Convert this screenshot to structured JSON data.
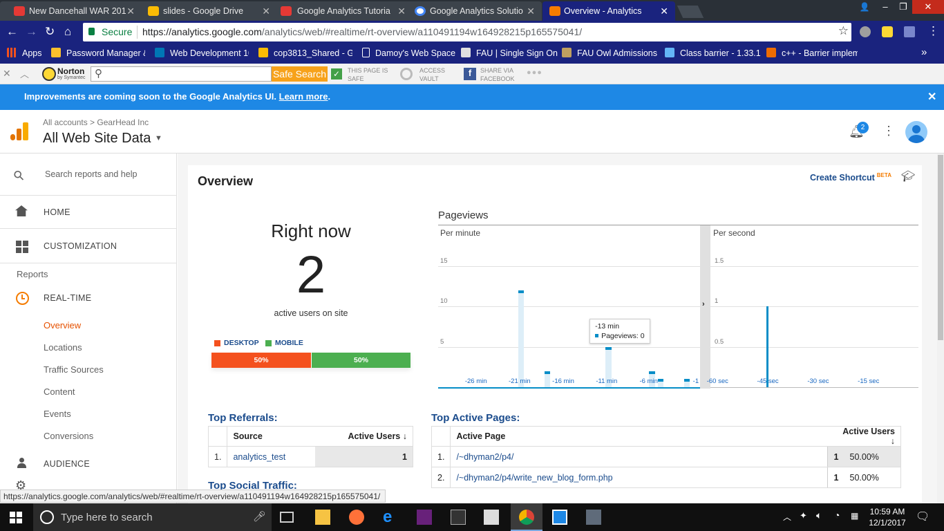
{
  "browser": {
    "tabs": [
      {
        "title": "New Dancehall WAR 201",
        "color": "#e53935"
      },
      {
        "title": "slides - Google Drive",
        "color": "#fbbc04"
      },
      {
        "title": "Google Analytics Tutoria",
        "color": "#e53935"
      },
      {
        "title": "Google Analytics Solutio",
        "color": "#4285f4"
      },
      {
        "title": "Overview - Analytics",
        "color": "#f57c00"
      }
    ],
    "secure_label": "Secure",
    "url_host": "https://analytics.google.com",
    "url_path": "/analytics/web/#realtime/rt-overview/a110491194w164928215p165575041/",
    "bookmarks": [
      {
        "label": "Apps",
        "color": "#f4511e"
      },
      {
        "label": "Password Manager &",
        "color": "#fbc02d"
      },
      {
        "label": "Web Development 10",
        "color": "#0077b5"
      },
      {
        "label": "cop3813_Shared - Go",
        "color": "#fbbc04"
      },
      {
        "label": "Damoy's Web Space",
        "color": "#ffffff"
      },
      {
        "label": "FAU | Single Sign On",
        "color": "#e0e0e0"
      },
      {
        "label": "FAU Owl Admissions",
        "color": "#c0a060"
      },
      {
        "label": "Class barrier - 1.33.1",
        "color": "#64b5f6"
      },
      {
        "label": "c++ - Barrier implem",
        "color": "#ef6c00"
      }
    ],
    "more": "»"
  },
  "norton": {
    "brand": "Norton",
    "brand_sub": "by Symantec",
    "search_button": "Safe Search",
    "safe_line1": "THIS PAGE IS",
    "safe_line2": "SAFE",
    "vault_line1": "ACCESS",
    "vault_line2": "VAULT",
    "fb_line1": "SHARE VIA",
    "fb_line2": "FACEBOOK",
    "more": "●●●"
  },
  "banner": {
    "text": "Improvements are coming soon to the Google Analytics UI. ",
    "link": "Learn more",
    "tail": ".",
    "close": "✕"
  },
  "header": {
    "breadcrumb_root": "All accounts",
    "breadcrumb_sep": ">",
    "breadcrumb_account": "GearHead Inc",
    "view_name": "All Web Site Data",
    "notif_count": "2"
  },
  "sidebar": {
    "search_placeholder": "Search reports and help",
    "home": "HOME",
    "customization": "CUSTOMIZATION",
    "reports_label": "Reports",
    "realtime": "REAL-TIME",
    "sub_items": [
      "Overview",
      "Locations",
      "Traffic Sources",
      "Content",
      "Events",
      "Conversions"
    ],
    "audience": "AUDIENCE"
  },
  "overview": {
    "title": "Overview",
    "create_shortcut": "Create Shortcut",
    "beta": "BETA",
    "right_now": "Right now",
    "active_users": "2",
    "active_users_label": "active users on site",
    "desktop_label": "DESKTOP",
    "mobile_label": "MOBILE",
    "desktop_pct": "50%",
    "mobile_pct": "50%",
    "desktop_share": 0.5,
    "colors": {
      "desktop": "#f4511e",
      "mobile": "#4caf50",
      "bar": "#058dc7"
    }
  },
  "chart_data": [
    {
      "type": "bar",
      "title": "Pageviews",
      "subtitle": "Per minute",
      "ylim": [
        0,
        20
      ],
      "yticks": [
        5,
        10,
        15
      ],
      "xticks": [
        "-26 min",
        "-21 min",
        "-16 min",
        "-11 min",
        "-6 min",
        "-1"
      ],
      "x": [
        -30,
        -29,
        -28,
        -27,
        -26,
        -25,
        -24,
        -23,
        -22,
        -21,
        -20,
        -19,
        -18,
        -17,
        -16,
        -15,
        -14,
        -13,
        -12,
        -11,
        -10,
        -9,
        -8,
        -7,
        -6,
        -5,
        -4,
        -3,
        -2,
        -1
      ],
      "values": [
        0,
        0,
        0,
        0,
        0,
        0,
        0,
        0,
        0,
        12,
        0,
        0,
        2,
        0,
        0,
        0,
        0,
        0,
        0,
        5,
        0,
        0,
        0,
        0,
        2,
        1,
        0,
        0,
        1,
        0
      ],
      "tooltip": {
        "title": "-13 min",
        "label": "Pageviews: 0"
      }
    },
    {
      "type": "bar",
      "subtitle": "Per second",
      "ylim": [
        0,
        2
      ],
      "yticks": [
        0.5,
        1,
        1.5
      ],
      "xticks": [
        "-60 sec",
        "-45 sec",
        "-30 sec",
        "-15 sec"
      ],
      "x": [
        -45
      ],
      "values": [
        1
      ]
    }
  ],
  "referrals": {
    "title": "Top Referrals:",
    "col_source": "Source",
    "col_users": "Active Users",
    "rows": [
      {
        "num": "1.",
        "source": "analytics_test",
        "users": "1"
      }
    ]
  },
  "social": {
    "title": "Top Social Traffic:"
  },
  "pages": {
    "title": "Top Active Pages:",
    "col_page": "Active Page",
    "col_users": "Active Users",
    "rows": [
      {
        "num": "1.",
        "page": "/~dhyman2/p4/",
        "users": "1",
        "pct": "50.00%"
      },
      {
        "num": "2.",
        "page": "/~dhyman2/p4/write_new_blog_form.php",
        "users": "1",
        "pct": "50.00%"
      }
    ]
  },
  "status_url": "https://analytics.google.com/analytics/web/#realtime/rt-overview/a110491194w164928215p165575041/",
  "taskbar": {
    "search_placeholder": "Type here to search",
    "time": "10:59 AM",
    "date": "12/1/2017"
  }
}
